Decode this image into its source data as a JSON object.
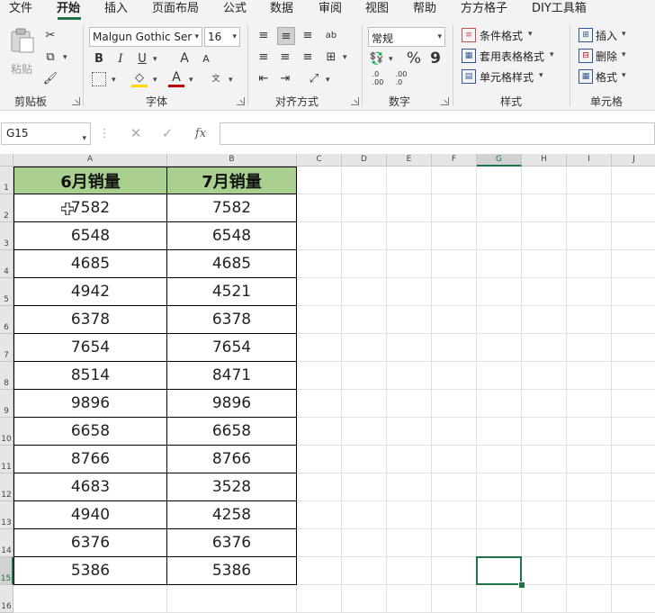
{
  "menu": {
    "tabs": [
      "文件",
      "开始",
      "插入",
      "页面布局",
      "公式",
      "数据",
      "审阅",
      "视图",
      "帮助",
      "方方格子",
      "DIY工具箱"
    ],
    "active": "开始"
  },
  "ribbon": {
    "clipboard": {
      "paste_label": "粘贴",
      "group_label": "剪贴板"
    },
    "font": {
      "font_name": "Malgun Gothic Ser",
      "font_size": "16",
      "bold": "B",
      "italic": "I",
      "underline": "U",
      "grow": "A",
      "shrink": "A",
      "group_label": "字体"
    },
    "align": {
      "group_label": "对齐方式"
    },
    "number": {
      "format": "常规",
      "percent": "%",
      "comma": "9",
      "group_label": "数字"
    },
    "styles": {
      "conditional": "条件格式",
      "table": "套用表格格式",
      "cell_styles": "单元格样式",
      "group_label": "样式"
    },
    "cells": {
      "insert": "插入",
      "delete": "删除",
      "format": "格式",
      "group_label": "单元格"
    }
  },
  "formula_bar": {
    "name_box": "G15",
    "formula": ""
  },
  "sheet": {
    "columns": [
      "A",
      "B",
      "C",
      "D",
      "E",
      "F",
      "G",
      "H",
      "I",
      "J"
    ],
    "selected_column": "G",
    "selected_row": "15",
    "rows": [
      "1",
      "2",
      "3",
      "4",
      "5",
      "6",
      "7",
      "8",
      "9",
      "10",
      "11",
      "12",
      "13",
      "14",
      "15",
      "16"
    ],
    "headers": [
      "6月销量",
      "7月销量"
    ],
    "header_color": "#a9d08e",
    "data": [
      [
        "7582",
        "7582"
      ],
      [
        "6548",
        "6548"
      ],
      [
        "4685",
        "4685"
      ],
      [
        "4942",
        "4521"
      ],
      [
        "6378",
        "6378"
      ],
      [
        "7654",
        "7654"
      ],
      [
        "8514",
        "8471"
      ],
      [
        "9896",
        "9896"
      ],
      [
        "6658",
        "6658"
      ],
      [
        "8766",
        "8766"
      ],
      [
        "4683",
        "3528"
      ],
      [
        "4940",
        "4258"
      ],
      [
        "6376",
        "6376"
      ],
      [
        "5386",
        "5386"
      ]
    ],
    "accent": "#217346"
  }
}
